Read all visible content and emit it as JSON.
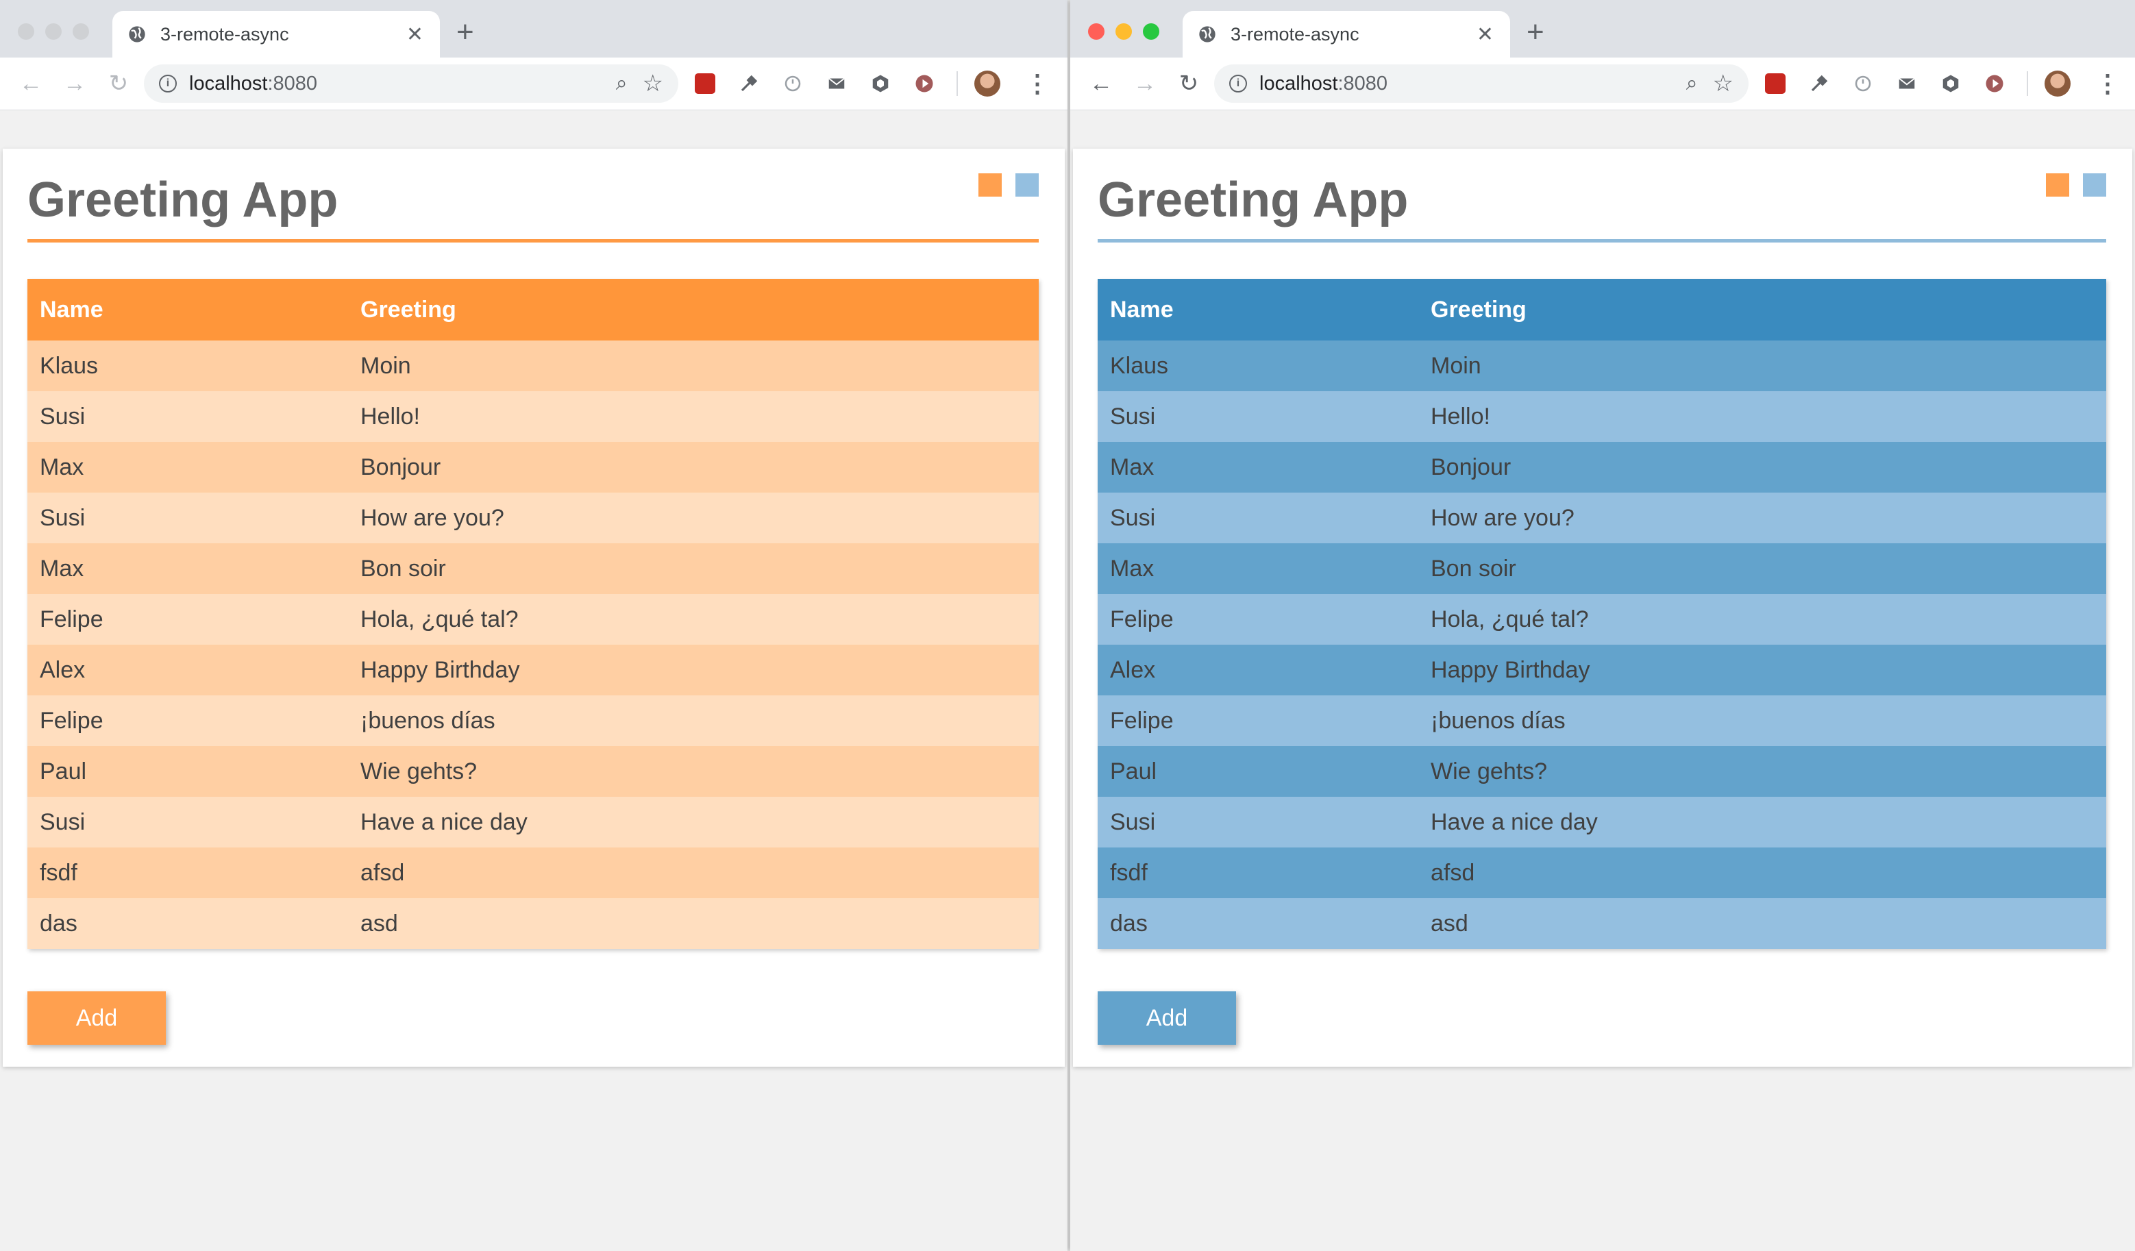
{
  "browser": {
    "tab_title": "3-remote-async",
    "close_glyph": "✕",
    "new_tab_glyph": "+",
    "url_host": "localhost",
    "url_port": ":8080"
  },
  "app": {
    "title": "Greeting App",
    "add_label": "Add",
    "columns": [
      "Name",
      "Greeting"
    ],
    "rows": [
      {
        "name": "Klaus",
        "greeting": "Moin"
      },
      {
        "name": "Susi",
        "greeting": "Hello!"
      },
      {
        "name": "Max",
        "greeting": "Bonjour"
      },
      {
        "name": "Susi",
        "greeting": "How are you?"
      },
      {
        "name": "Max",
        "greeting": "Bon soir"
      },
      {
        "name": "Felipe",
        "greeting": "Hola, ¿qué tal?"
      },
      {
        "name": "Alex",
        "greeting": "Happy Birthday"
      },
      {
        "name": "Felipe",
        "greeting": "¡buenos días"
      },
      {
        "name": "Paul",
        "greeting": "Wie gehts?"
      },
      {
        "name": "Susi",
        "greeting": "Have a nice day"
      },
      {
        "name": "fsdf",
        "greeting": "afsd"
      },
      {
        "name": "das",
        "greeting": "asd"
      }
    ]
  },
  "themes": {
    "orange": {
      "header": "#ff963a",
      "rule": "#ff9a45",
      "row_odd": "#ffcfa3",
      "row_even": "#ffdebf",
      "button": "#ffa04f"
    },
    "blue": {
      "header": "#3a8bbf",
      "rule": "#8fbbdb",
      "row_odd": "#63a3cc",
      "row_even": "#94bfe0",
      "button": "#63a3cc"
    }
  },
  "swatch_colors": {
    "orange": "#ffa04f",
    "blue": "#94bfe0"
  },
  "traffic_lights": {
    "inactive": "#cfd1d4",
    "close": "#ff5f57",
    "minimize": "#febc2e",
    "zoom": "#28c840"
  },
  "extension_icons": [
    "red-extension-icon",
    "eyedropper-icon",
    "timer-icon",
    "mail-icon",
    "cube-icon",
    "play-icon"
  ]
}
